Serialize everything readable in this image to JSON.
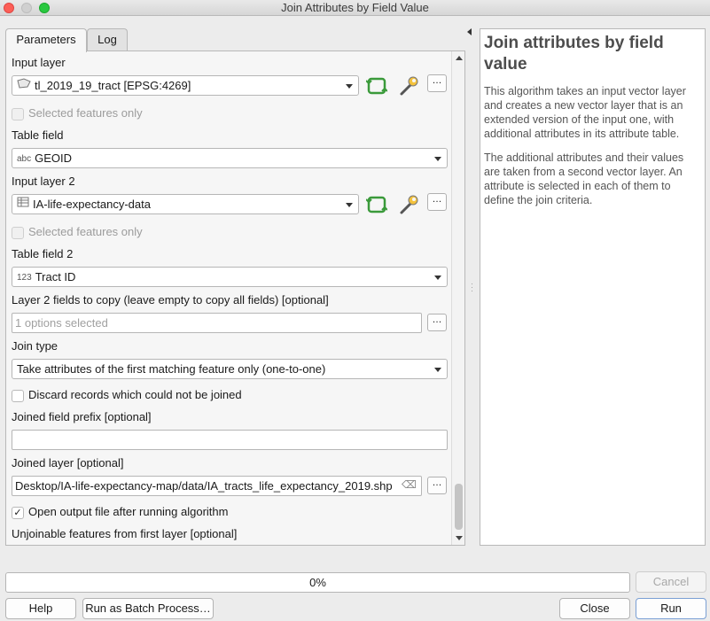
{
  "window": {
    "title": "Join Attributes by Field Value"
  },
  "tabs": {
    "parameters": "Parameters",
    "log": "Log"
  },
  "form": {
    "input_layer_label": "Input layer",
    "input_layer_value": "tl_2019_19_tract [EPSG:4269]",
    "selected_only_1": "Selected features only",
    "table_field_label": "Table field",
    "table_field_type": "abc",
    "table_field_value": "GEOID",
    "input_layer2_label": "Input layer 2",
    "input_layer2_value": "IA-life-expectancy-data",
    "selected_only_2": "Selected features only",
    "table_field2_label": "Table field 2",
    "table_field2_type": "123",
    "table_field2_value": "Tract ID",
    "fields_to_copy_label": "Layer 2 fields to copy (leave empty to copy all fields) [optional]",
    "fields_to_copy_placeholder": "1 options selected",
    "join_type_label": "Join type",
    "join_type_value": "Take attributes of the first matching feature only (one-to-one)",
    "discard_label": "Discard records which could not be joined",
    "prefix_label": "Joined field prefix [optional]",
    "prefix_value": "",
    "joined_layer_label": "Joined layer [optional]",
    "joined_layer_value": "Desktop/IA-life-expectancy-map/data/IA_tracts_life_expectancy_2019.shp",
    "open_output_label": "Open output file after running algorithm",
    "unjoinable_label": "Unjoinable features from first layer [optional]",
    "ellipsis": "…",
    "clear_glyph": "⌫"
  },
  "help": {
    "title": "Join attributes by field value",
    "p1": "This algorithm takes an input vector layer and creates a new vector layer that is an extended version of the input one, with additional attributes in its attribute table.",
    "p2": "The additional attributes and their values are taken from a second vector layer. An attribute is selected in each of them to define the join criteria."
  },
  "progress": {
    "text": "0%",
    "value_percent": 0
  },
  "buttons": {
    "cancel": "Cancel",
    "help": "Help",
    "batch": "Run as Batch Process…",
    "close": "Close",
    "run": "Run"
  },
  "colors": {
    "iterate_icon": "#3a9a3a",
    "accent": "#7a9fd4"
  }
}
